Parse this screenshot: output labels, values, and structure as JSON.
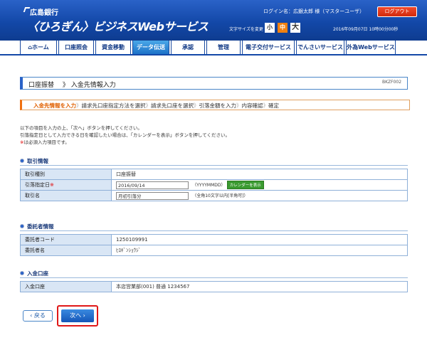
{
  "header": {
    "bank_name": "広島銀行",
    "service_title": "〈ひろぎん〉ビジネスWebサービス",
    "login_name": "ログイン名：広銀太郎 様（マスターユーザ）",
    "logout": "ログアウト",
    "font_size_label": "文字サイズを変更",
    "font_small": "小",
    "font_mid": "中",
    "font_large": "大",
    "datetime": "2016年09月07日 10時00分00秒"
  },
  "nav": {
    "tabs": [
      {
        "label": "ホーム",
        "active": false
      },
      {
        "label": "口座照会",
        "active": false
      },
      {
        "label": "資金移動",
        "active": false
      },
      {
        "label": "データ伝送",
        "active": true
      },
      {
        "label": "承認",
        "active": false
      },
      {
        "label": "管理",
        "active": false
      },
      {
        "label": "電子交付サービス",
        "active": false
      },
      {
        "label": "でんさいサービス",
        "active": false
      },
      {
        "label": "外為Webサービス",
        "active": false
      }
    ]
  },
  "page": {
    "title_category": "口座振替",
    "title_page": "入金先情報入力",
    "screen_id": "BKZF002"
  },
  "steps": {
    "current": "入金先情報を入力",
    "rest": [
      "請求先口座指定方法を選択",
      "請求先口座を選択",
      "引落金額を入力",
      "内容確認",
      "確定"
    ]
  },
  "instructions": {
    "line1": "以下の項目を入力の上、「次へ」ボタンを押してください。",
    "line2": "引落指定日として入力できる日を確認したい場合は、「カレンダーを表示」ボタンを押してください。",
    "line3_mark": "※",
    "line3": "は必須入力項目です。"
  },
  "transaction": {
    "section_title": "取引情報",
    "type_label": "取引種別",
    "type_value": "口座振替",
    "date_label": "引落指定日",
    "date_value": "2016/09/14",
    "date_format": "（YYYYMMDD）",
    "calendar_button": "カレンダーを表示",
    "name_label": "取引名",
    "name_value": "月初引落分",
    "name_hint": "（全角10文字以内[半角可]）"
  },
  "consignor": {
    "section_title": "委託者情報",
    "code_label": "委託者コード",
    "code_value": "1250109991",
    "name_label": "委託者名",
    "name_value": "ﾋﾛｷﾞﾝｼｮｳｼﾞ"
  },
  "deposit": {
    "section_title": "入金口座",
    "account_label": "入金口座",
    "account_value": "本店営業部(001) 普通 1234567"
  },
  "buttons": {
    "back": "戻る",
    "next": "次へ"
  }
}
